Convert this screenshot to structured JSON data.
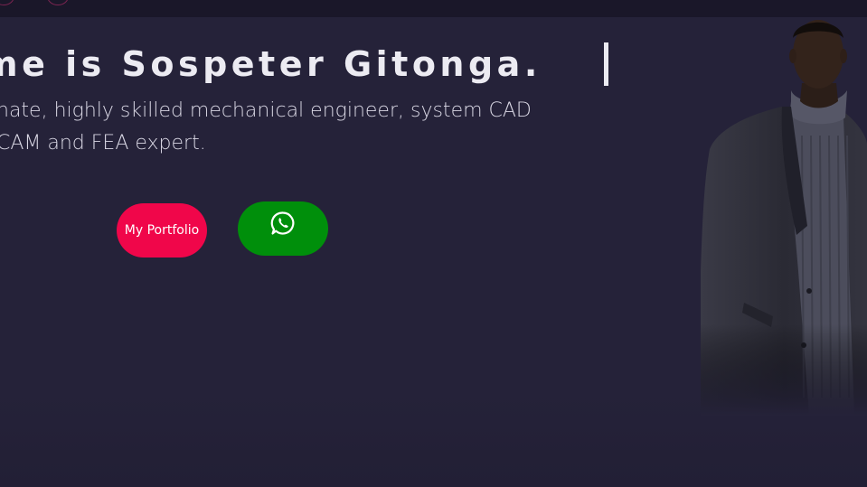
{
  "hero": {
    "headline": "me is Sospeter Gitonga.",
    "description": "nate, highly skilled mechanical engineer, system CAD CAM and FEA expert.",
    "portfolio_button": "My Portfolio",
    "whatsapp_icon": "whatsapp-icon",
    "portrait_alt": "portrait-photo"
  },
  "colors": {
    "background": "#252239",
    "topbar": "#1a1729",
    "portfolio_button": "#f0064a",
    "whatsapp_button": "#008f0b",
    "text": "#ecebf2"
  }
}
